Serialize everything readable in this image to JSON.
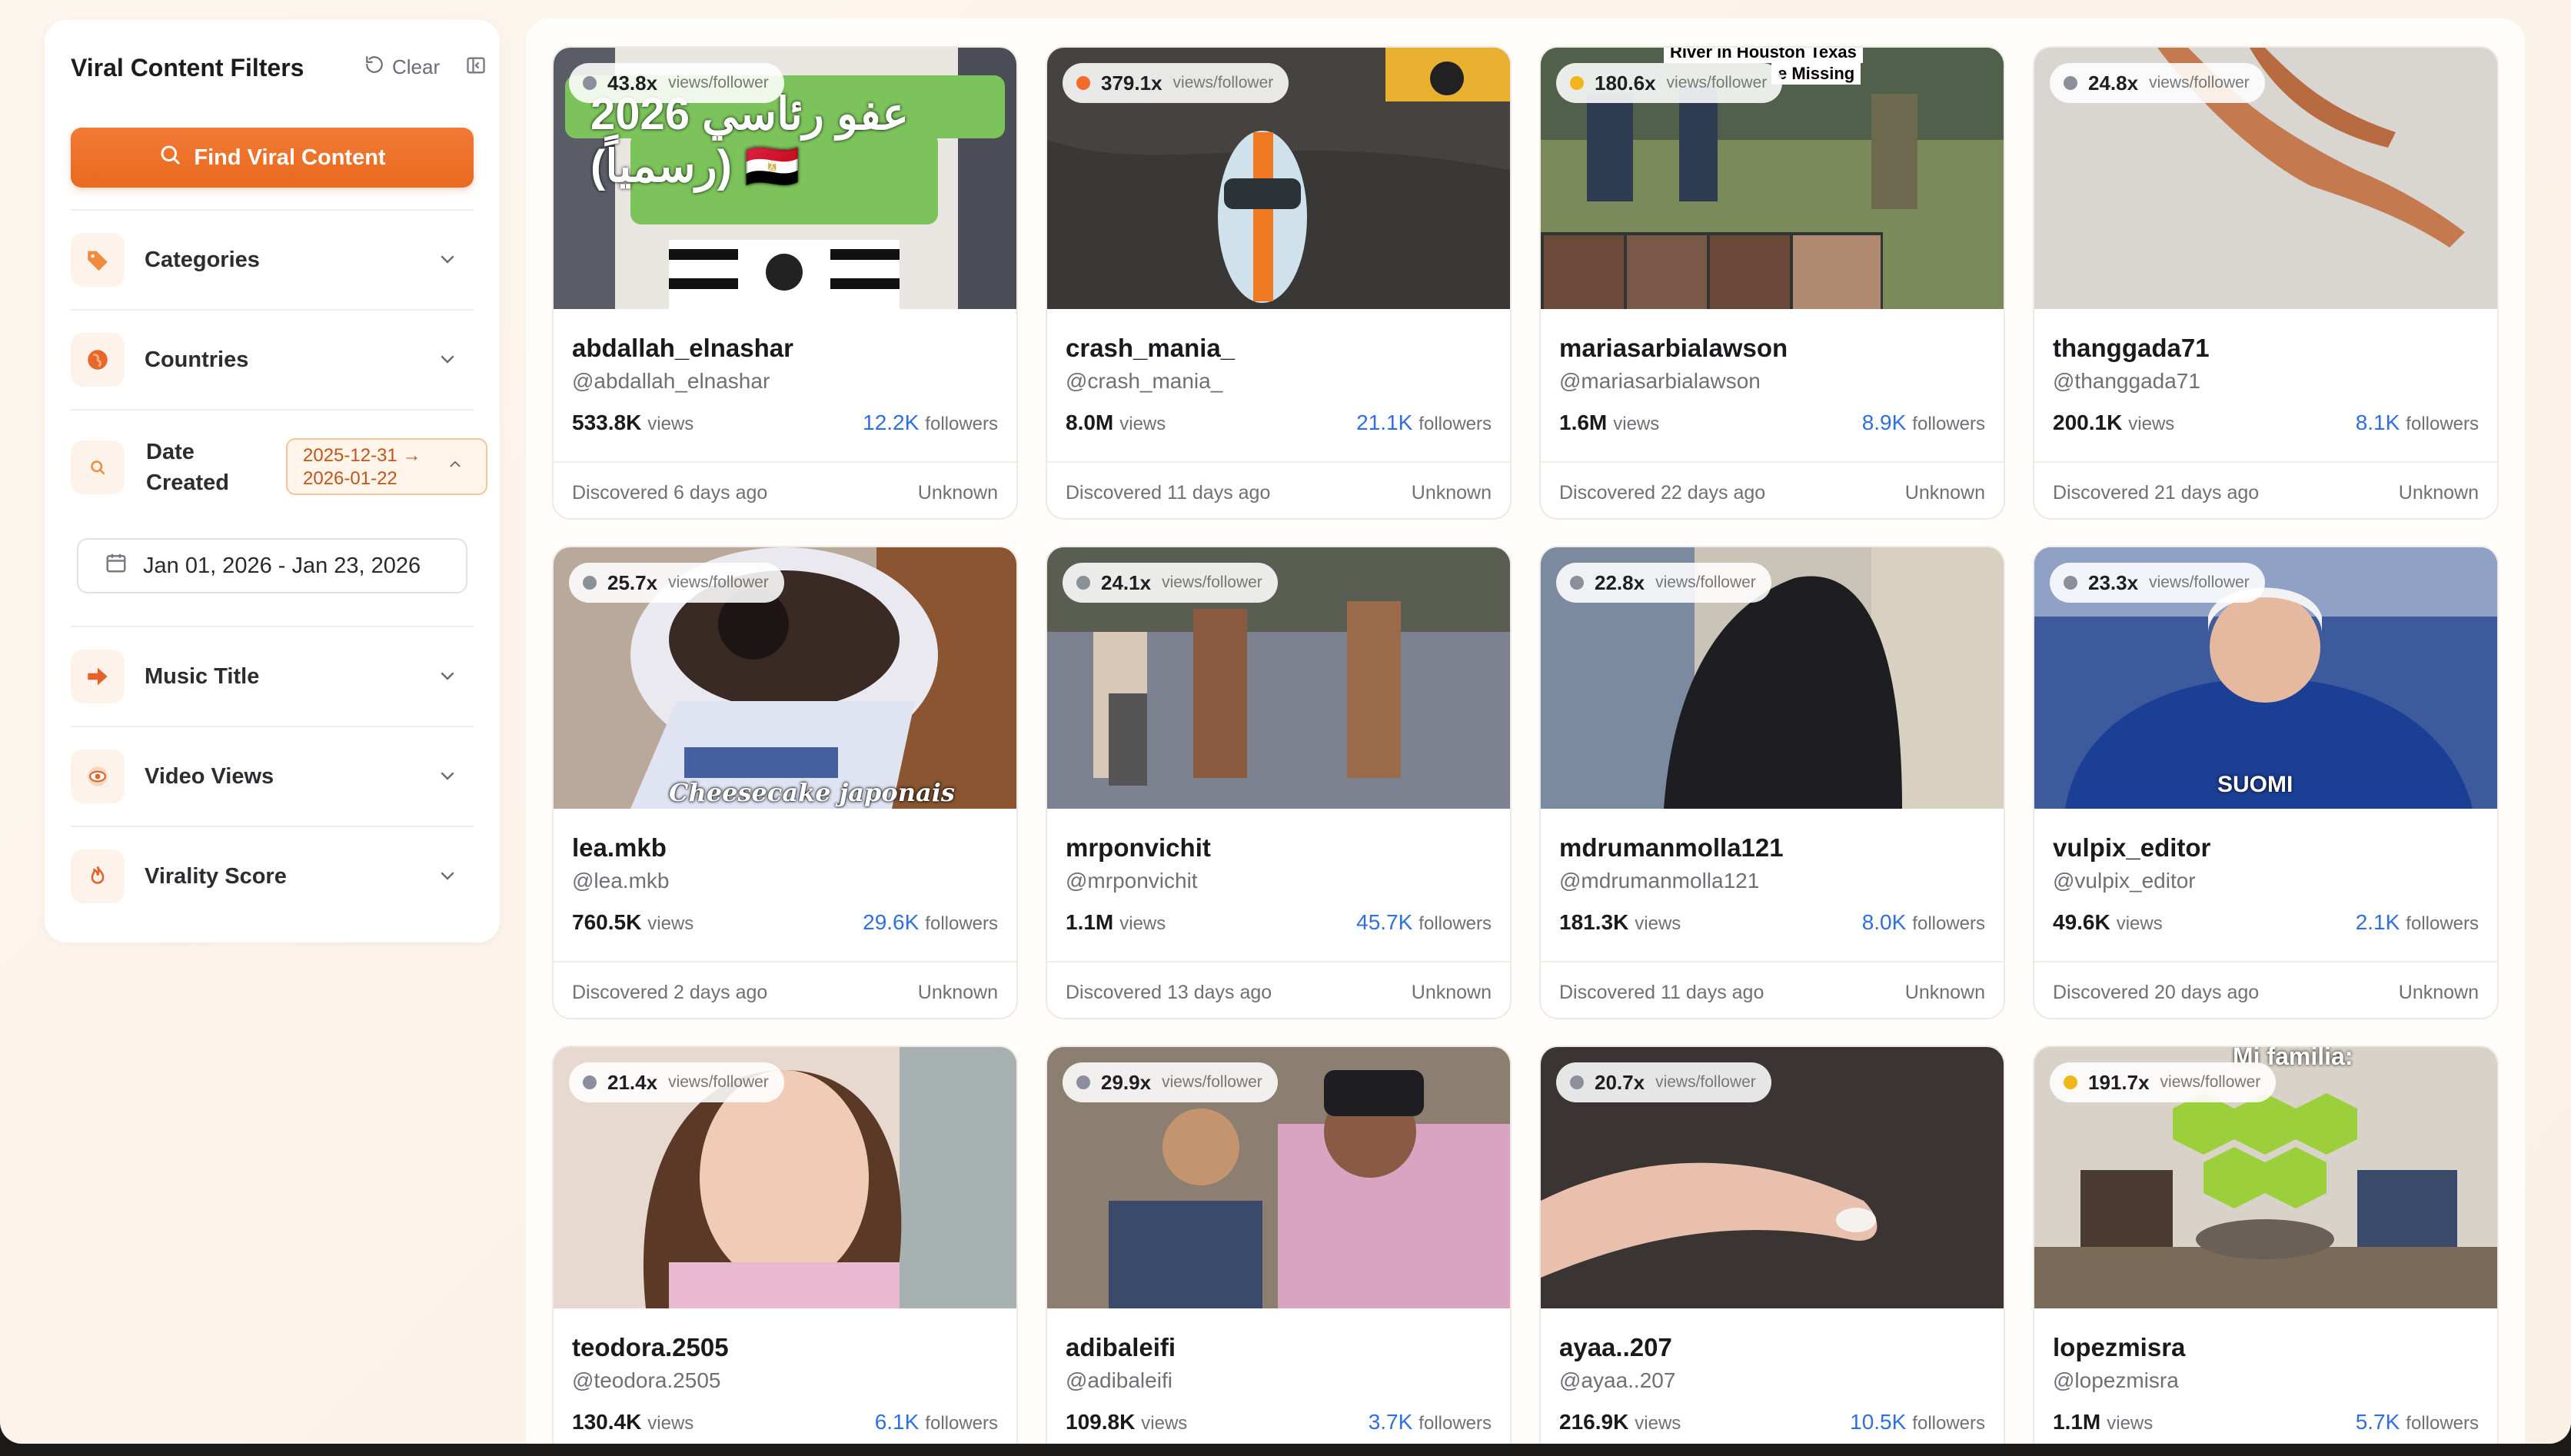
{
  "sidebar": {
    "title": "Viral Content Filters",
    "clear_label": "Clear",
    "find_button": "Find Viral Content",
    "sections": {
      "categories": "Categories",
      "countries": "Countries",
      "date_created": "Date Created",
      "music_title": "Music Title",
      "video_views": "Video Views",
      "virality_score": "Virality Score"
    },
    "date_badge_line1": "2025-12-31 →",
    "date_badge_line2": "2026-01-22",
    "date_range_value": "Jan 01, 2026 - Jan 23, 2026"
  },
  "labels": {
    "views_per_follower": "views/follower",
    "views": "views",
    "followers": "followers"
  },
  "colors": {
    "accent": "#ed6f25",
    "followers_blue": "#2f6fe0",
    "dot_gray": "#8a8f99",
    "dot_orange": "#f26b2a",
    "dot_yellow": "#f2b61d"
  },
  "cards": [
    {
      "ratio": "43.8x",
      "dot": "gray",
      "name": "abdallah_elnashar",
      "handle": "@abdallah_elnashar",
      "views": "533.8K",
      "followers": "12.2K",
      "discovered": "Discovered 6 days ago",
      "country": "Unknown",
      "overlay_text": "عفو رئاسي 2026 (رسمياً) 🇪🇬"
    },
    {
      "ratio": "379.1x",
      "dot": "orange",
      "name": "crash_mania_",
      "handle": "@crash_mania_",
      "views": "8.0M",
      "followers": "21.1K",
      "discovered": "Discovered 11 days ago",
      "country": "Unknown"
    },
    {
      "ratio": "180.6x",
      "dot": "yellow",
      "name": "mariasarbialawson",
      "handle": "@mariasarbialawson",
      "views": "1.6M",
      "followers": "8.9K",
      "discovered": "Discovered 22 days ago",
      "country": "Unknown",
      "overlay_text_1": "River in Houston Texas",
      "overlay_text_2": "e Missing"
    },
    {
      "ratio": "24.8x",
      "dot": "gray",
      "name": "thanggada71",
      "handle": "@thanggada71",
      "views": "200.1K",
      "followers": "8.1K",
      "discovered": "Discovered 21 days ago",
      "country": "Unknown"
    },
    {
      "ratio": "25.7x",
      "dot": "gray",
      "name": "lea.mkb",
      "handle": "@lea.mkb",
      "views": "760.5K",
      "followers": "29.6K",
      "discovered": "Discovered 2 days ago",
      "country": "Unknown",
      "overlay_text": "Cheesecake japonais"
    },
    {
      "ratio": "24.1x",
      "dot": "gray",
      "name": "mrponvichit",
      "handle": "@mrponvichit",
      "views": "1.1M",
      "followers": "45.7K",
      "discovered": "Discovered 13 days ago",
      "country": "Unknown"
    },
    {
      "ratio": "22.8x",
      "dot": "gray",
      "name": "mdrumanmolla121",
      "handle": "@mdrumanmolla121",
      "views": "181.3K",
      "followers": "8.0K",
      "discovered": "Discovered 11 days ago",
      "country": "Unknown"
    },
    {
      "ratio": "23.3x",
      "dot": "gray",
      "name": "vulpix_editor",
      "handle": "@vulpix_editor",
      "views": "49.6K",
      "followers": "2.1K",
      "discovered": "Discovered 20 days ago",
      "country": "Unknown",
      "overlay_text": "SUOMI"
    },
    {
      "ratio": "21.4x",
      "dot": "gray",
      "name": "teodora.2505",
      "handle": "@teodora.2505",
      "views": "130.4K",
      "followers": "6.1K",
      "discovered": "",
      "country": ""
    },
    {
      "ratio": "29.9x",
      "dot": "gray",
      "name": "adibaleifi",
      "handle": "@adibaleifi",
      "views": "109.8K",
      "followers": "3.7K",
      "discovered": "",
      "country": ""
    },
    {
      "ratio": "20.7x",
      "dot": "gray",
      "name": "ayaa..207",
      "handle": "@ayaa..207",
      "views": "216.9K",
      "followers": "10.5K",
      "discovered": "",
      "country": ""
    },
    {
      "ratio": "191.7x",
      "dot": "yellow",
      "name": "lopezmisra",
      "handle": "@lopezmisra",
      "views": "1.1M",
      "followers": "5.7K",
      "discovered": "",
      "country": "",
      "overlay_text": "Mi familia:"
    }
  ]
}
